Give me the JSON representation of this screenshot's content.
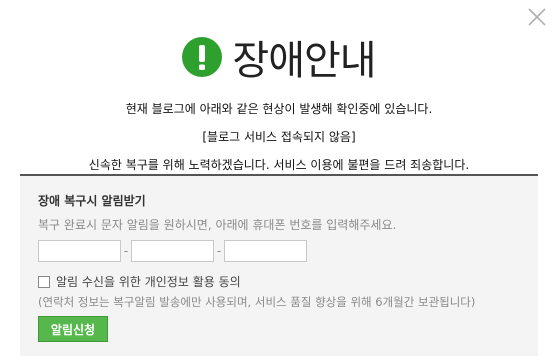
{
  "title": "장애안내",
  "messages": {
    "line1": "현재 블로그에 아래와 같은 현상이 발생해 확인중에 있습니다.",
    "line2": "[블로그 서비스 접속되지 않음]",
    "line3": "신속한 복구를 위해 노력하겠습니다. 서비스 이용에 불편을 드려 죄송합니다."
  },
  "panel": {
    "title": "장애 복구시 알림받기",
    "description": "복구 완료시 문자 알림을 원하시면, 아래에 휴대폰 번호를 입력해주세요.",
    "phone_fields": [
      "",
      "",
      ""
    ],
    "separator": "-",
    "consent_label": "알림 수신을 위한 개인정보 활용 동의",
    "consent_checked": false,
    "note": "(연락처 정보는 복구알림 발송에만 사용되며, 서비스 품질 향상을 위해 6개월간 보관됩니다)",
    "button_label": "알림신청"
  },
  "icons": {
    "close": "close-icon",
    "alert": "exclamation-icon"
  },
  "colors": {
    "accent_green": "#2ea02e",
    "button_green": "#56b84c",
    "panel_bg": "#f4f4f4"
  }
}
